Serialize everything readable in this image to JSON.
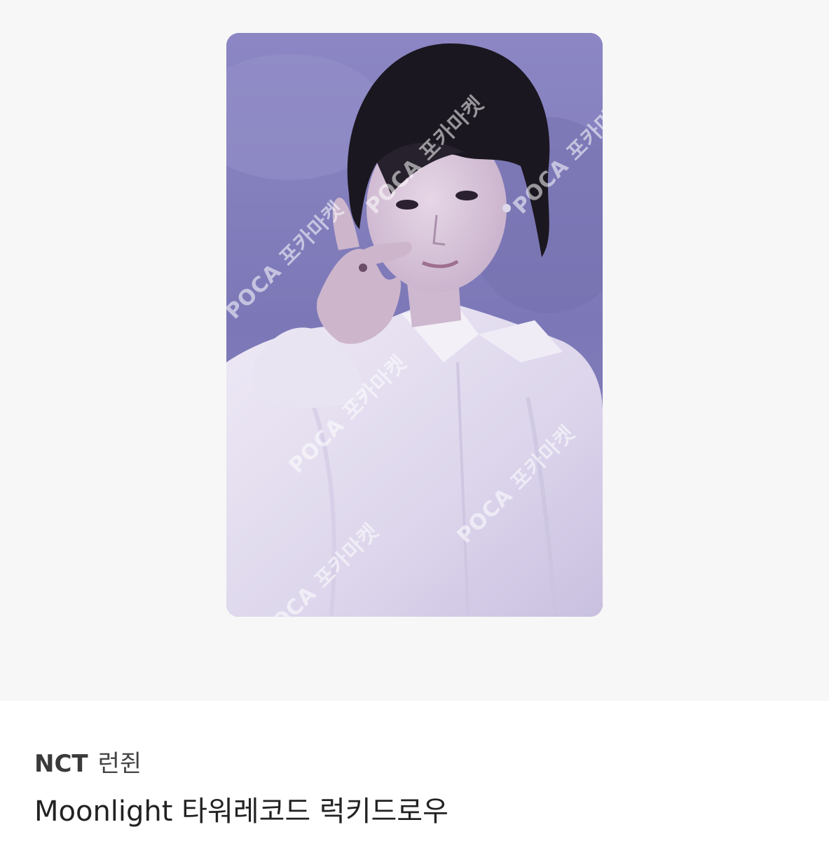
{
  "product": {
    "image": {
      "description_icon": "photocard-image",
      "watermark_text": "POCA 포카마켓",
      "colors": {
        "background": "#8a85c2",
        "shirt": "#e8e4f2",
        "hair": "#1c1820",
        "skin": "#d9c6d9"
      }
    },
    "group": "NCT",
    "member": "런쥔",
    "title": "Moonlight 타워레코드 럭키드로우"
  },
  "colors": {
    "gallery_bg": "#f7f7f7",
    "page_bg": "#ffffff",
    "text_primary": "#222222"
  }
}
